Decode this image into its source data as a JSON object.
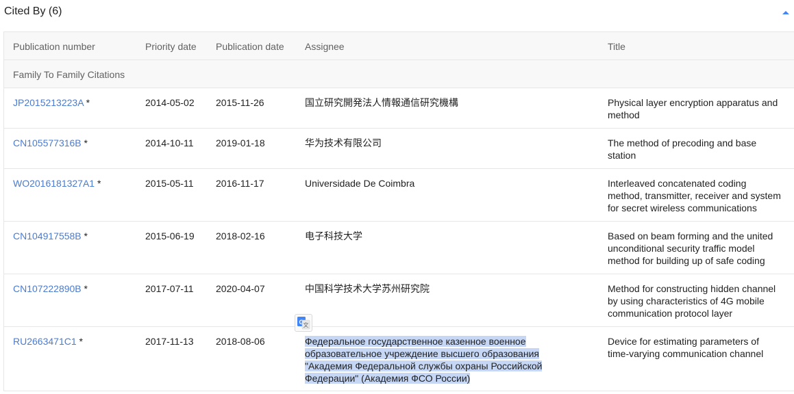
{
  "section": {
    "title": "Cited By (6)"
  },
  "table": {
    "headers": {
      "publication_number": "Publication number",
      "priority_date": "Priority date",
      "publication_date": "Publication date",
      "assignee": "Assignee",
      "title": "Title"
    },
    "group_label": "Family To Family Citations",
    "rows": [
      {
        "publication_number": "JP2015213223A",
        "star": "*",
        "priority_date": "2014-05-02",
        "publication_date": "2015-11-26",
        "assignee": "国立研究開発法人情報通信研究機構",
        "title": [
          "Physical layer encryption apparatus and",
          "method"
        ]
      },
      {
        "publication_number": "CN105577316B",
        "star": "*",
        "priority_date": "2014-10-11",
        "publication_date": "2019-01-18",
        "assignee": "华为技术有限公司",
        "title": [
          "The method of precoding and base",
          "station"
        ]
      },
      {
        "publication_number": "WO2016181327A1",
        "star": "*",
        "priority_date": "2015-05-11",
        "publication_date": "2016-11-17",
        "assignee": "Universidade De Coimbra",
        "title": [
          "Interleaved concatenated coding",
          "method, transmitter, receiver and system",
          "for secret wireless communications"
        ]
      },
      {
        "publication_number": "CN104917558B",
        "star": "*",
        "priority_date": "2015-06-19",
        "publication_date": "2018-02-16",
        "assignee": "电子科技大学",
        "title": [
          "Based on beam forming and the united",
          "unconditional security traffic model",
          "method for building up of safe coding"
        ]
      },
      {
        "publication_number": "CN107222890B",
        "star": "*",
        "priority_date": "2017-07-11",
        "publication_date": "2020-04-07",
        "assignee": "中国科学技术大学苏州研究院",
        "title": [
          "Method for constructing hidden channel",
          "by using characteristics of 4G mobile",
          "communication protocol layer"
        ]
      },
      {
        "publication_number": "RU2663471C1",
        "star": "*",
        "priority_date": "2017-11-13",
        "publication_date": "2018-08-06",
        "assignee_lines": [
          "Федеральное государственное казенное военное",
          "образовательное учреждение высшего образования",
          "\"Академия Федеральной службы охраны Российской",
          "Федерации\" (Академия ФСО России)"
        ],
        "title": [
          "Device for estimating parameters of",
          "time-varying communication channel"
        ]
      }
    ]
  },
  "icons": {
    "collapse": "chevron-up-icon",
    "translate": "google-translate-icon"
  },
  "colors": {
    "link": "#4a7bd0",
    "accent": "#4285f4",
    "selection": "#c5d7f5"
  }
}
